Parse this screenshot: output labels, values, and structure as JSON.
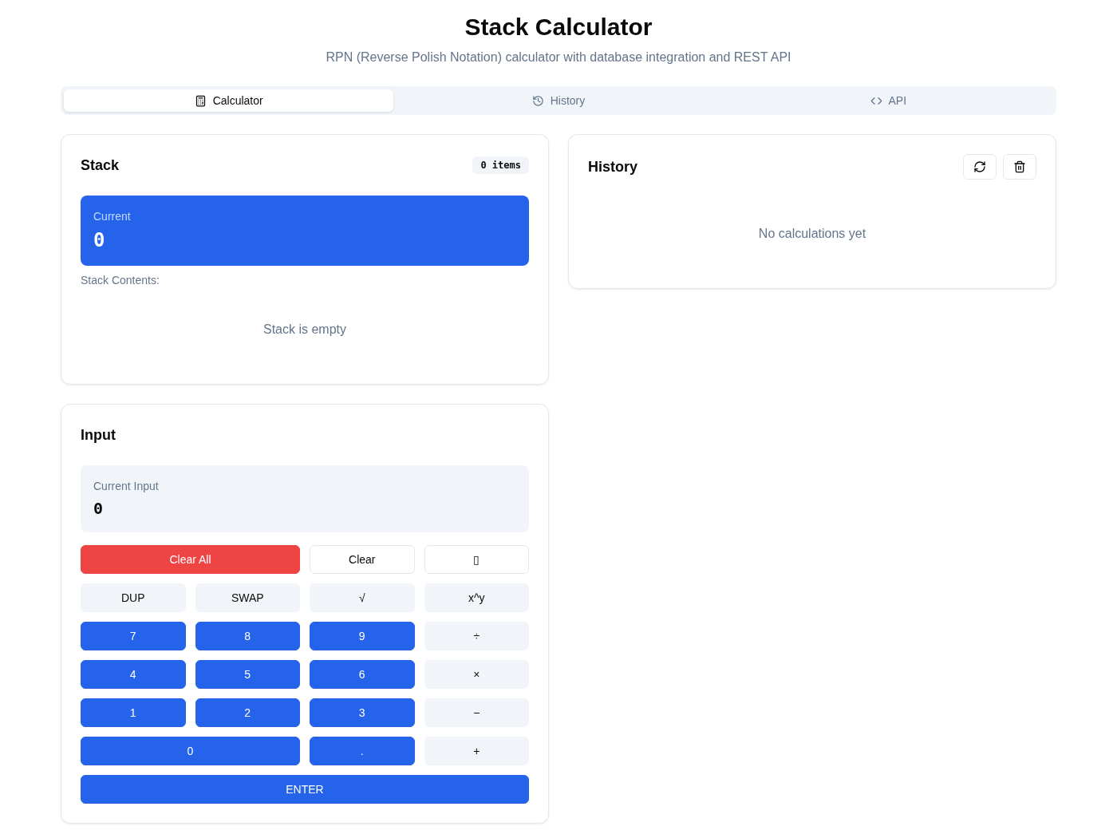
{
  "header": {
    "title": "Stack Calculator",
    "subtitle": "RPN (Reverse Polish Notation) calculator with database integration and REST API"
  },
  "tabs": [
    {
      "label": "Calculator",
      "selected": true
    },
    {
      "label": "History",
      "selected": false
    },
    {
      "label": "API",
      "selected": false
    }
  ],
  "stack_panel": {
    "title": "Stack",
    "count_badge": "0 items",
    "current": {
      "label": "Current",
      "value": "0"
    },
    "contents_label": "Stack Contents:",
    "empty_message": "Stack is empty"
  },
  "input_panel": {
    "title": "Input",
    "current_input": {
      "label": "Current Input",
      "value": "0"
    },
    "keys": [
      {
        "label": "Clear All",
        "kind": "danger",
        "wide": true
      },
      {
        "label": "Clear",
        "kind": "outline",
        "wide": false
      },
      {
        "label": "▯",
        "kind": "outline",
        "wide": false
      },
      {
        "label": "DUP",
        "kind": "secondary",
        "wide": false
      },
      {
        "label": "SWAP",
        "kind": "secondary",
        "wide": false
      },
      {
        "label": "√",
        "kind": "secondary",
        "wide": false
      },
      {
        "label": "x^y",
        "kind": "secondary",
        "wide": false
      },
      {
        "label": "7",
        "kind": "digit",
        "wide": false
      },
      {
        "label": "8",
        "kind": "digit",
        "wide": false
      },
      {
        "label": "9",
        "kind": "digit",
        "wide": false
      },
      {
        "label": "÷",
        "kind": "secondary",
        "wide": false
      },
      {
        "label": "4",
        "kind": "digit",
        "wide": false
      },
      {
        "label": "5",
        "kind": "digit",
        "wide": false
      },
      {
        "label": "6",
        "kind": "digit",
        "wide": false
      },
      {
        "label": "×",
        "kind": "secondary",
        "wide": false
      },
      {
        "label": "1",
        "kind": "digit",
        "wide": false
      },
      {
        "label": "2",
        "kind": "digit",
        "wide": false
      },
      {
        "label": "3",
        "kind": "digit",
        "wide": false
      },
      {
        "label": "−",
        "kind": "secondary",
        "wide": false
      },
      {
        "label": "0",
        "kind": "digit",
        "wide": true
      },
      {
        "label": ".",
        "kind": "digit",
        "wide": false
      },
      {
        "label": "+",
        "kind": "secondary",
        "wide": false
      }
    ],
    "enter_key": "ENTER"
  },
  "history_panel": {
    "title": "History",
    "empty_message": "No calculations yet"
  }
}
